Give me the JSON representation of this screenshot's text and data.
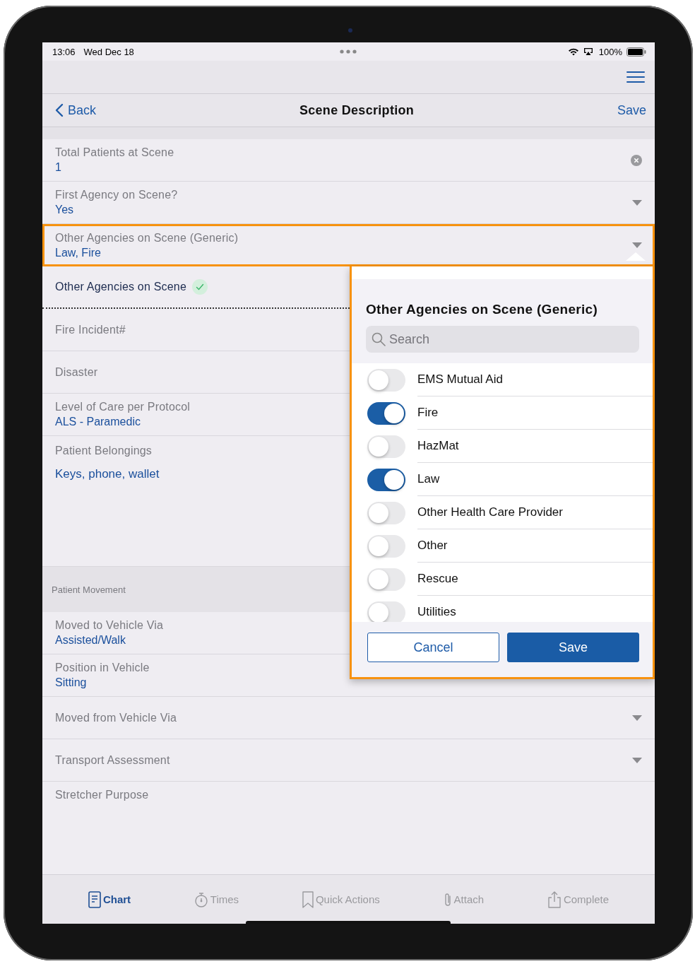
{
  "status_bar": {
    "time": "13:06",
    "date": "Wed Dec 18",
    "battery": "100%"
  },
  "nav_bar": {
    "back": "Back",
    "title": "Scene Description",
    "save": "Save"
  },
  "fields": [
    {
      "kind": "clearable",
      "label": "Total Patients at Scene",
      "value": "1"
    },
    {
      "kind": "dropdown",
      "label": "First Agency on Scene?",
      "value": "Yes"
    },
    {
      "kind": "dropdown",
      "label": "Other Agencies on Scene (Generic)",
      "value": "Law, Fire",
      "highlighted": true
    },
    {
      "kind": "field",
      "label": "Other Agencies on Scene",
      "validated": true
    },
    {
      "kind": "field",
      "label": "Fire Incident#"
    },
    {
      "kind": "field",
      "label": "Disaster"
    },
    {
      "kind": "field",
      "label": "Level of Care per Protocol",
      "value": "ALS - Paramedic"
    },
    {
      "kind": "notes",
      "label": "Patient Belongings",
      "value": "Keys, phone, wallet"
    },
    {
      "kind": "section",
      "label": "Patient Movement"
    },
    {
      "kind": "field",
      "label": "Moved to Vehicle Via",
      "value": "Assisted/Walk"
    },
    {
      "kind": "field",
      "label": "Position in Vehicle",
      "value": "Sitting"
    },
    {
      "kind": "dropdown",
      "label": "Moved from Vehicle Via"
    },
    {
      "kind": "dropdown",
      "label": "Transport Assessment"
    },
    {
      "kind": "field",
      "label": "Stretcher Purpose"
    }
  ],
  "popover": {
    "title": "Other Agencies on Scene (Generic)",
    "search": {
      "placeholder": "Search"
    },
    "options": [
      {
        "label": "EMS Mutual Aid",
        "on": false
      },
      {
        "label": "Fire",
        "on": true
      },
      {
        "label": "HazMat",
        "on": false
      },
      {
        "label": "Law",
        "on": true
      },
      {
        "label": "Other Health Care Provider",
        "on": false
      },
      {
        "label": "Other",
        "on": false
      },
      {
        "label": "Rescue",
        "on": false
      },
      {
        "label": "Utilities",
        "on": false
      }
    ],
    "cancel": "Cancel",
    "save": "Save"
  },
  "tab_bar": [
    {
      "label": "Chart",
      "selected": true
    },
    {
      "label": "Times",
      "selected": false
    },
    {
      "label": "Quick Actions",
      "selected": false
    },
    {
      "label": "Attach",
      "selected": false
    },
    {
      "label": "Complete",
      "selected": false
    }
  ]
}
